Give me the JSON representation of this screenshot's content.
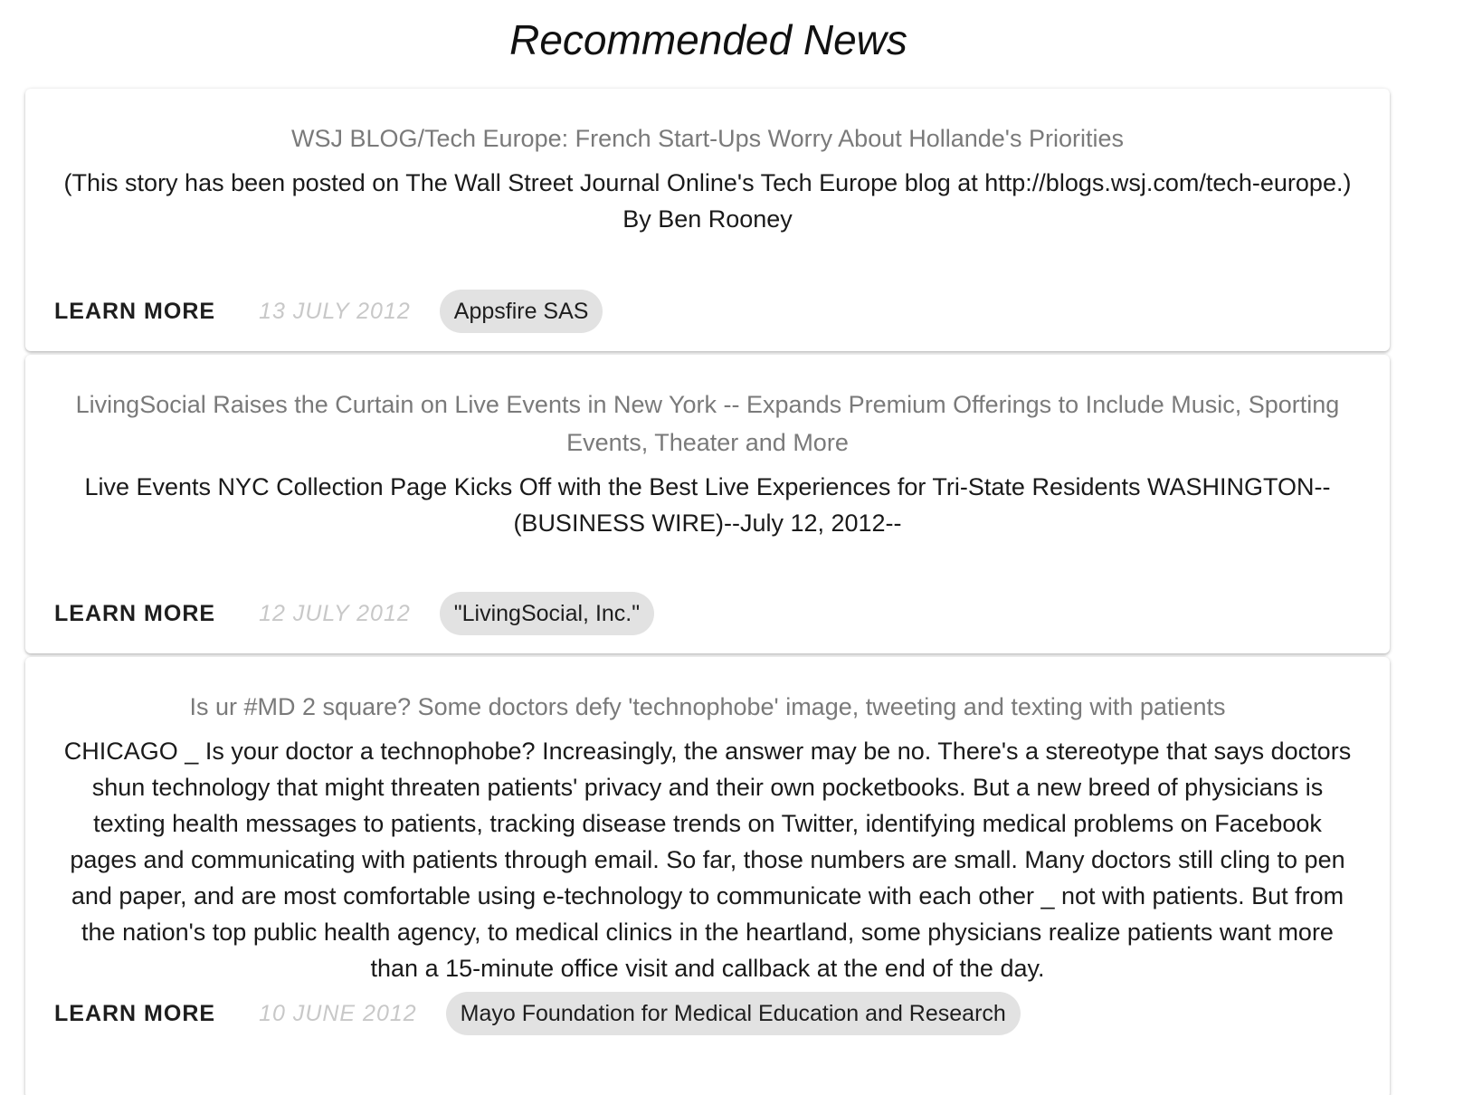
{
  "page": {
    "title": "Recommended News"
  },
  "articles": [
    {
      "headline": "WSJ BLOG/Tech Europe: French Start-Ups Worry About Hollande's Priorities",
      "summary": "(This story has been posted on The Wall Street Journal Online's Tech Europe blog at http://blogs.wsj.com/tech-europe.) By Ben Rooney",
      "action_label": "LEARN MORE",
      "date": "13 JULY 2012",
      "company": "Appsfire SAS"
    },
    {
      "headline": "LivingSocial Raises the Curtain on Live Events in New York -- Expands Premium Offerings to Include Music, Sporting Events, Theater and More",
      "summary": "Live Events NYC Collection Page Kicks Off with the Best Live Experiences for Tri-State Residents WASHINGTON--(BUSINESS WIRE)--July 12, 2012--",
      "action_label": "LEARN MORE",
      "date": "12 JULY 2012",
      "company": "\"LivingSocial, Inc.\""
    },
    {
      "headline": "Is ur #MD 2 square? Some doctors defy 'technophobe' image, tweeting and texting with patients",
      "summary": "CHICAGO _ Is your doctor a technophobe? Increasingly, the answer may be no. There's a stereotype that says doctors shun technology that might threaten patients' privacy and their own pocketbooks. But a new breed of physicians is texting health messages to patients, tracking disease trends on Twitter, identifying medical problems on Facebook pages and communicating with patients through email. So far, those numbers are small. Many doctors still cling to pen and paper, and are most comfortable using e-technology to communicate with each other _ not with patients. But from the nation's top public health agency, to medical clinics in the heartland, some physicians realize patients want more than a 15-minute office visit and callback at the end of the day.",
      "action_label": "LEARN MORE",
      "date": "10 JUNE 2012",
      "company": "Mayo Foundation for Medical Education and Research"
    }
  ]
}
